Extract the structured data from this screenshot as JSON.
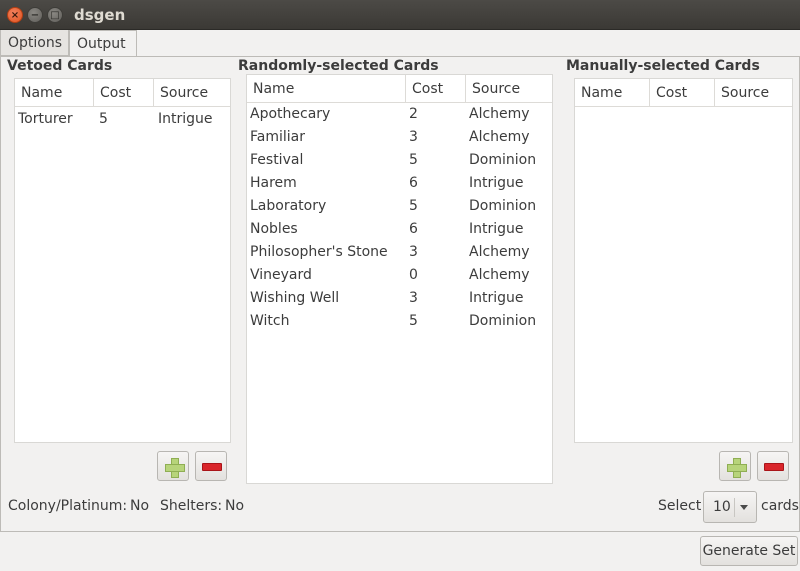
{
  "window": {
    "title": "dsgen",
    "controls": [
      "close-icon",
      "minimize-icon",
      "maximize-icon"
    ]
  },
  "tabs": [
    {
      "label": "Options",
      "active": false
    },
    {
      "label": "Output",
      "active": true
    }
  ],
  "vetoed": {
    "title": "Vetoed Cards",
    "columns": [
      "Name",
      "Cost",
      "Source"
    ],
    "rows": [
      {
        "name": "Torturer",
        "cost": "5",
        "source": "Intrigue"
      }
    ]
  },
  "random": {
    "title": "Randomly-selected Cards",
    "columns": [
      "Name",
      "Cost",
      "Source"
    ],
    "rows": [
      {
        "name": "Apothecary",
        "cost": "2",
        "source": "Alchemy"
      },
      {
        "name": "Familiar",
        "cost": "3",
        "source": "Alchemy"
      },
      {
        "name": "Festival",
        "cost": "5",
        "source": "Dominion"
      },
      {
        "name": "Harem",
        "cost": "6",
        "source": "Intrigue"
      },
      {
        "name": "Laboratory",
        "cost": "5",
        "source": "Dominion"
      },
      {
        "name": "Nobles",
        "cost": "6",
        "source": "Intrigue"
      },
      {
        "name": "Philosopher's Stone",
        "cost": "3",
        "source": "Alchemy"
      },
      {
        "name": "Vineyard",
        "cost": "0",
        "source": "Alchemy"
      },
      {
        "name": "Wishing Well",
        "cost": "3",
        "source": "Intrigue"
      },
      {
        "name": "Witch",
        "cost": "5",
        "source": "Dominion"
      }
    ]
  },
  "manual": {
    "title": "Manually-selected Cards",
    "columns": [
      "Name",
      "Cost",
      "Source"
    ],
    "rows": []
  },
  "status": {
    "colony_label": "Colony/Platinum:",
    "colony_value": "No",
    "shelters_label": "Shelters:",
    "shelters_value": "No"
  },
  "select": {
    "prefix": "Select",
    "value": "10",
    "suffix": "cards"
  },
  "generate_label": "Generate Set",
  "colors": {
    "accent_close": "#e0531f",
    "add_icon": "#b7d47a",
    "remove_icon": "#d9252a"
  }
}
